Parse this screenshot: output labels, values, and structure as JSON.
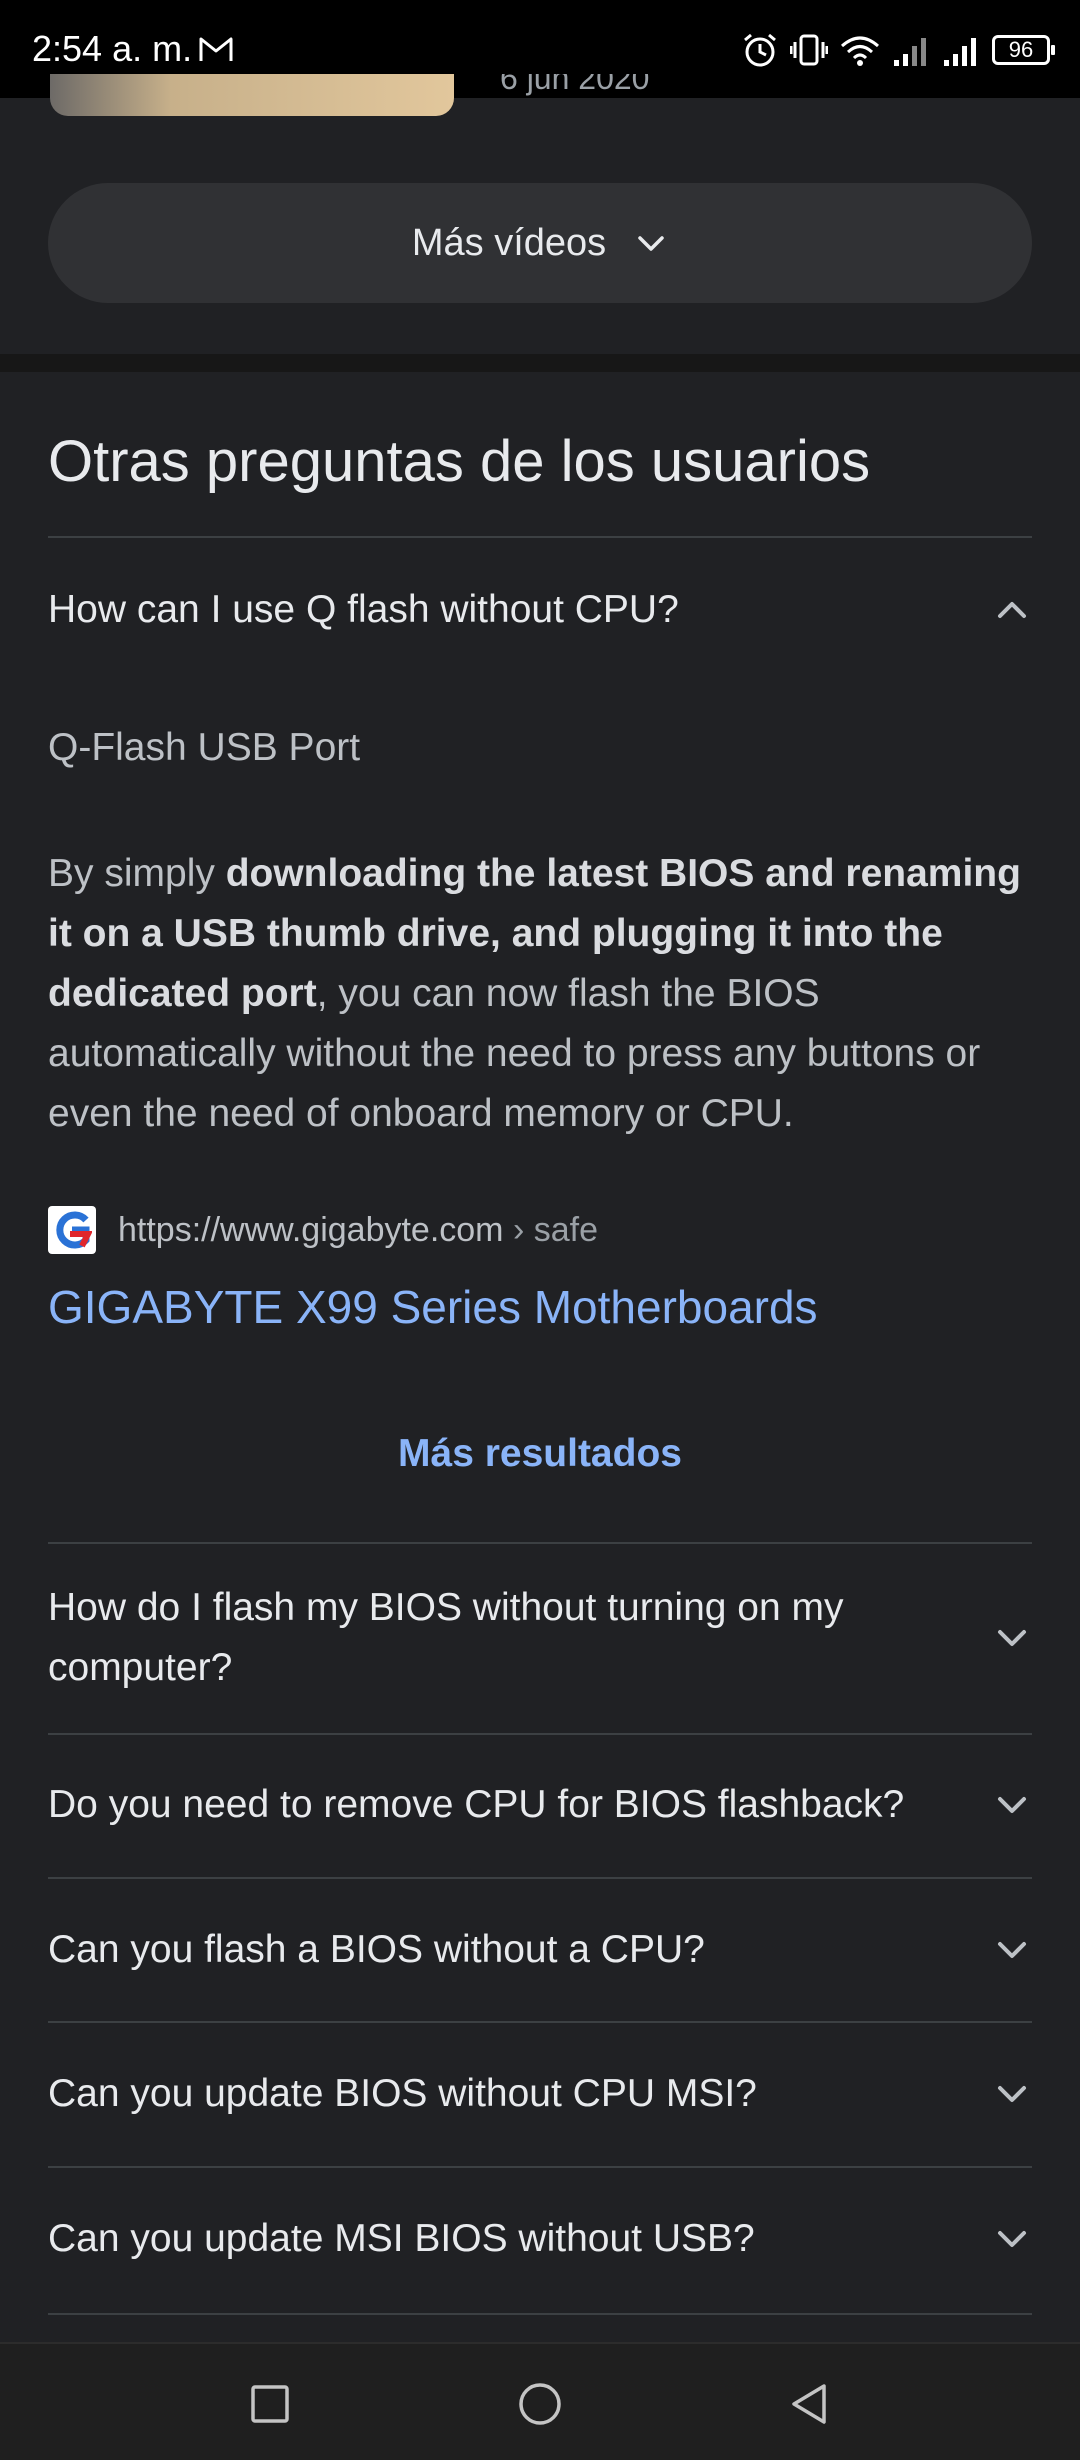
{
  "status_bar": {
    "time": "2:54 a. m.",
    "battery": "96"
  },
  "video": {
    "date_partial": "6 jun 2020"
  },
  "more_videos_label": "Más vídeos",
  "section_title": "Otras preguntas de los usuarios",
  "faq": [
    {
      "question": "How can I use Q flash without CPU?",
      "expanded": true
    },
    {
      "question": "How do I flash my BIOS without turning on my computer?",
      "expanded": false
    },
    {
      "question": "Do you need to remove CPU for BIOS flashback?",
      "expanded": false
    },
    {
      "question": "Can you flash a BIOS without a CPU?",
      "expanded": false
    },
    {
      "question": "Can you update BIOS without CPU MSI?",
      "expanded": false
    },
    {
      "question": "Can you update MSI BIOS without USB?",
      "expanded": false
    }
  ],
  "answer": {
    "title": "Q-Flash USB Port",
    "intro": "By simply ",
    "bold": "downloading the latest BIOS and renaming it on a USB thumb drive, and plugging it into the dedicated port",
    "rest": ", you can now flash the BIOS automatically without the need to press any buttons or even the need of onboard memory or CPU.",
    "source_url": "https://www.gigabyte.com",
    "source_crumb": " › safe",
    "source_title": "GIGABYTE X99 Series Motherboards"
  },
  "more_results_label": "Más resultados",
  "colors": {
    "background": "#202124",
    "link": "#8ab4f8",
    "pill": "#303134"
  }
}
